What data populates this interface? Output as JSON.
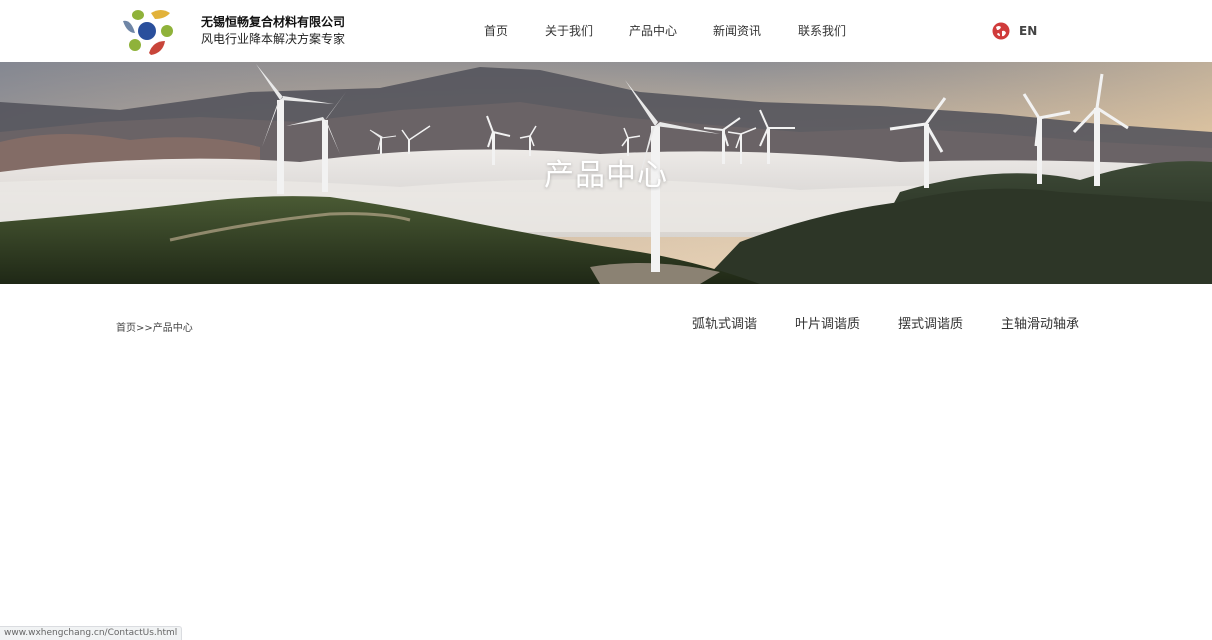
{
  "header": {
    "company_name": "无锡恒畅复合材料有限公司",
    "slogan": "风电行业降本解决方案专家",
    "nav": [
      "首页",
      "关于我们",
      "产品中心",
      "新闻资讯",
      "联系我们"
    ],
    "language": "EN"
  },
  "banner": {
    "title": "产品中心"
  },
  "breadcrumb": {
    "home": "首页",
    "separator": ">>",
    "current": "产品中心"
  },
  "categories": [
    "弧轨式调谐",
    "叶片调谐质",
    "摆式调谐质",
    "主轴滑动轴承"
  ],
  "status_bar": {
    "url": "www.wxhengchang.cn/ContactUs.html"
  },
  "colors": {
    "logo_blue": "#2a4f9c",
    "logo_yellow": "#e2b23a",
    "logo_green": "#8fb23a",
    "logo_red": "#c8453a",
    "logo_slate": "#6f86a6",
    "globe_red": "#d03b3b"
  }
}
